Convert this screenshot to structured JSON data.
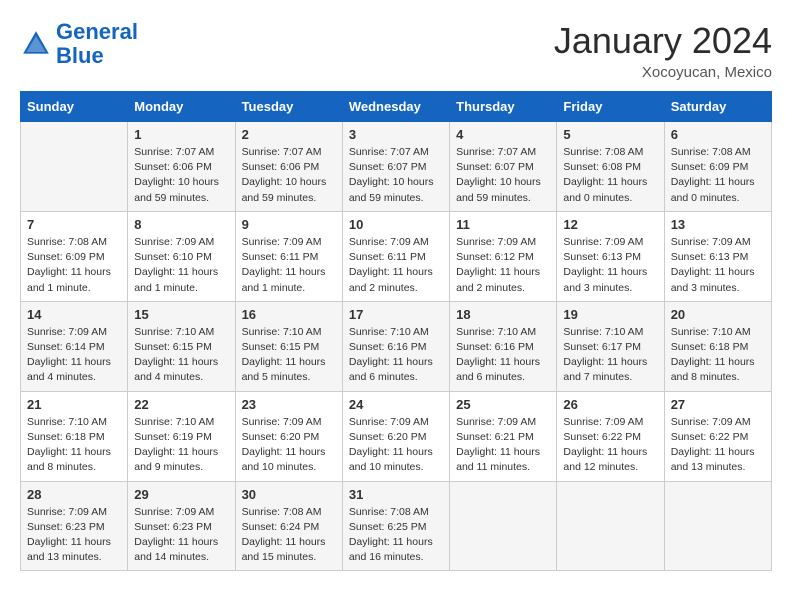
{
  "header": {
    "logo_line1": "General",
    "logo_line2": "Blue",
    "month": "January 2024",
    "location": "Xocoyucan, Mexico"
  },
  "days_of_week": [
    "Sunday",
    "Monday",
    "Tuesday",
    "Wednesday",
    "Thursday",
    "Friday",
    "Saturday"
  ],
  "weeks": [
    [
      {
        "day": "",
        "info": ""
      },
      {
        "day": "1",
        "info": "Sunrise: 7:07 AM\nSunset: 6:06 PM\nDaylight: 10 hours\nand 59 minutes."
      },
      {
        "day": "2",
        "info": "Sunrise: 7:07 AM\nSunset: 6:06 PM\nDaylight: 10 hours\nand 59 minutes."
      },
      {
        "day": "3",
        "info": "Sunrise: 7:07 AM\nSunset: 6:07 PM\nDaylight: 10 hours\nand 59 minutes."
      },
      {
        "day": "4",
        "info": "Sunrise: 7:07 AM\nSunset: 6:07 PM\nDaylight: 10 hours\nand 59 minutes."
      },
      {
        "day": "5",
        "info": "Sunrise: 7:08 AM\nSunset: 6:08 PM\nDaylight: 11 hours\nand 0 minutes."
      },
      {
        "day": "6",
        "info": "Sunrise: 7:08 AM\nSunset: 6:09 PM\nDaylight: 11 hours\nand 0 minutes."
      }
    ],
    [
      {
        "day": "7",
        "info": "Sunrise: 7:08 AM\nSunset: 6:09 PM\nDaylight: 11 hours\nand 1 minute."
      },
      {
        "day": "8",
        "info": "Sunrise: 7:09 AM\nSunset: 6:10 PM\nDaylight: 11 hours\nand 1 minute."
      },
      {
        "day": "9",
        "info": "Sunrise: 7:09 AM\nSunset: 6:11 PM\nDaylight: 11 hours\nand 1 minute."
      },
      {
        "day": "10",
        "info": "Sunrise: 7:09 AM\nSunset: 6:11 PM\nDaylight: 11 hours\nand 2 minutes."
      },
      {
        "day": "11",
        "info": "Sunrise: 7:09 AM\nSunset: 6:12 PM\nDaylight: 11 hours\nand 2 minutes."
      },
      {
        "day": "12",
        "info": "Sunrise: 7:09 AM\nSunset: 6:13 PM\nDaylight: 11 hours\nand 3 minutes."
      },
      {
        "day": "13",
        "info": "Sunrise: 7:09 AM\nSunset: 6:13 PM\nDaylight: 11 hours\nand 3 minutes."
      }
    ],
    [
      {
        "day": "14",
        "info": "Sunrise: 7:09 AM\nSunset: 6:14 PM\nDaylight: 11 hours\nand 4 minutes."
      },
      {
        "day": "15",
        "info": "Sunrise: 7:10 AM\nSunset: 6:15 PM\nDaylight: 11 hours\nand 4 minutes."
      },
      {
        "day": "16",
        "info": "Sunrise: 7:10 AM\nSunset: 6:15 PM\nDaylight: 11 hours\nand 5 minutes."
      },
      {
        "day": "17",
        "info": "Sunrise: 7:10 AM\nSunset: 6:16 PM\nDaylight: 11 hours\nand 6 minutes."
      },
      {
        "day": "18",
        "info": "Sunrise: 7:10 AM\nSunset: 6:16 PM\nDaylight: 11 hours\nand 6 minutes."
      },
      {
        "day": "19",
        "info": "Sunrise: 7:10 AM\nSunset: 6:17 PM\nDaylight: 11 hours\nand 7 minutes."
      },
      {
        "day": "20",
        "info": "Sunrise: 7:10 AM\nSunset: 6:18 PM\nDaylight: 11 hours\nand 8 minutes."
      }
    ],
    [
      {
        "day": "21",
        "info": "Sunrise: 7:10 AM\nSunset: 6:18 PM\nDaylight: 11 hours\nand 8 minutes."
      },
      {
        "day": "22",
        "info": "Sunrise: 7:10 AM\nSunset: 6:19 PM\nDaylight: 11 hours\nand 9 minutes."
      },
      {
        "day": "23",
        "info": "Sunrise: 7:09 AM\nSunset: 6:20 PM\nDaylight: 11 hours\nand 10 minutes."
      },
      {
        "day": "24",
        "info": "Sunrise: 7:09 AM\nSunset: 6:20 PM\nDaylight: 11 hours\nand 10 minutes."
      },
      {
        "day": "25",
        "info": "Sunrise: 7:09 AM\nSunset: 6:21 PM\nDaylight: 11 hours\nand 11 minutes."
      },
      {
        "day": "26",
        "info": "Sunrise: 7:09 AM\nSunset: 6:22 PM\nDaylight: 11 hours\nand 12 minutes."
      },
      {
        "day": "27",
        "info": "Sunrise: 7:09 AM\nSunset: 6:22 PM\nDaylight: 11 hours\nand 13 minutes."
      }
    ],
    [
      {
        "day": "28",
        "info": "Sunrise: 7:09 AM\nSunset: 6:23 PM\nDaylight: 11 hours\nand 13 minutes."
      },
      {
        "day": "29",
        "info": "Sunrise: 7:09 AM\nSunset: 6:23 PM\nDaylight: 11 hours\nand 14 minutes."
      },
      {
        "day": "30",
        "info": "Sunrise: 7:08 AM\nSunset: 6:24 PM\nDaylight: 11 hours\nand 15 minutes."
      },
      {
        "day": "31",
        "info": "Sunrise: 7:08 AM\nSunset: 6:25 PM\nDaylight: 11 hours\nand 16 minutes."
      },
      {
        "day": "",
        "info": ""
      },
      {
        "day": "",
        "info": ""
      },
      {
        "day": "",
        "info": ""
      }
    ]
  ]
}
